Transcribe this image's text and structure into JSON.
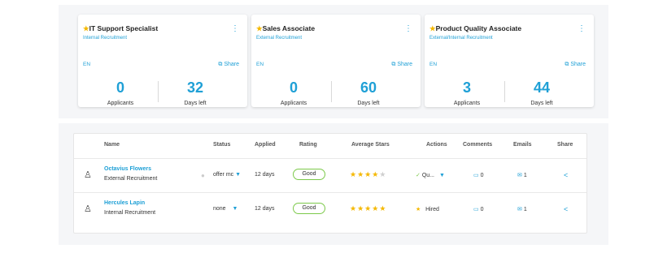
{
  "cards": [
    {
      "title": "IT Support Specialist",
      "subtitle": "Internal Recruitment",
      "lang": "EN",
      "share": "Share",
      "applicants": "0",
      "applicants_label": "Applicants",
      "days": "32",
      "days_label": "Days left"
    },
    {
      "title": "Sales Associate",
      "subtitle": "External Recruitment",
      "lang": "EN",
      "share": "Share",
      "applicants": "0",
      "applicants_label": "Applicants",
      "days": "60",
      "days_label": "Days left"
    },
    {
      "title": "Product Quality Associate",
      "subtitle": "External/Internal Recruitment",
      "lang": "EN",
      "share": "Share",
      "applicants": "3",
      "applicants_label": "Applicants",
      "days": "44",
      "days_label": "Days left"
    }
  ],
  "table": {
    "headers": {
      "name": "Name",
      "status": "Status",
      "applied": "Applied",
      "rating": "Rating",
      "avg_stars": "Average Stars",
      "actions": "Actions",
      "comments": "Comments",
      "emails": "Emails",
      "share": "Share"
    },
    "rows": [
      {
        "name": "Octavius Flowers",
        "recruitment": "External Recruitment",
        "status": "offer mc",
        "applied": "12 days",
        "rating": "Good",
        "stars": 4,
        "action": "Qu...",
        "comments": "0",
        "emails": "1"
      },
      {
        "name": "Hercules Lapin",
        "recruitment": "Internal Recruitment",
        "status": "none",
        "applied": "12 days",
        "rating": "Good",
        "stars": 5,
        "action": "Hired",
        "comments": "0",
        "emails": "1"
      }
    ]
  },
  "colors": {
    "accent": "#1fa0d6",
    "star": "#f5b800",
    "good_border": "#7cc94a",
    "panel_bg": "#f5f6f8"
  },
  "icons": {
    "menu": "kebab-menu-icon",
    "share": "external-link-icon",
    "user": "user-icon",
    "comment": "comment-icon",
    "email": "envelope-icon",
    "share_row": "share-nodes-icon",
    "check": "check-icon",
    "star": "star-icon"
  }
}
